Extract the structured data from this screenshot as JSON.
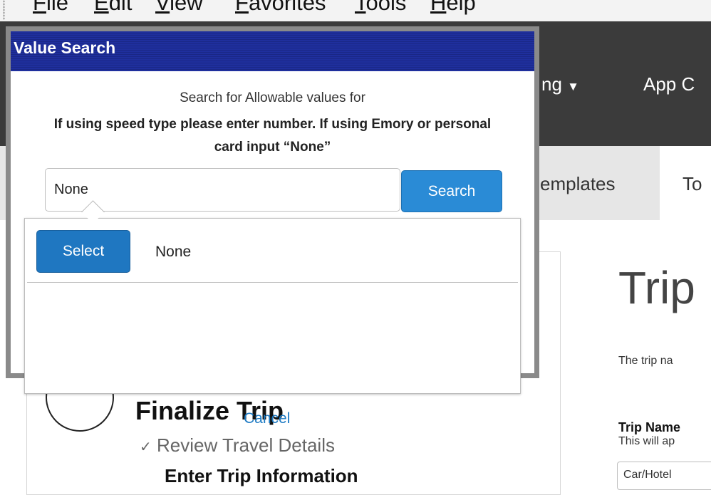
{
  "menubar": {
    "items": [
      "File",
      "Edit",
      "View",
      "Favorites",
      "Tools",
      "Help"
    ]
  },
  "topnav": {
    "item_partial_1": "ng",
    "item_partial_2": "App C"
  },
  "subnav": {
    "tab_partial_1": "emplates",
    "tab_partial_2": "To"
  },
  "progress": {
    "step_title": "Finalize Trip",
    "cancel_label": "Cancel",
    "review_label": "Review Travel Details",
    "enter_label": "Enter Trip Information"
  },
  "trip": {
    "heading": "Trip",
    "description": "The trip na",
    "name_label": "Trip Name",
    "name_help": "This will ap",
    "name_value": "Car/Hotel"
  },
  "dialog": {
    "title": "Value Search",
    "prompt": "Search for Allowable values for",
    "instruction": "If using speed type please enter number. If using Emory or personal card input “None”",
    "search_value": "None",
    "search_button": "Search",
    "results": [
      {
        "select_label": "Select",
        "value": "None"
      }
    ]
  },
  "colors": {
    "titlebar": "#1f2f9d",
    "primary_button": "#2a8bd6",
    "nav_bg": "#3b3b3b",
    "link": "#1e7bc4"
  }
}
